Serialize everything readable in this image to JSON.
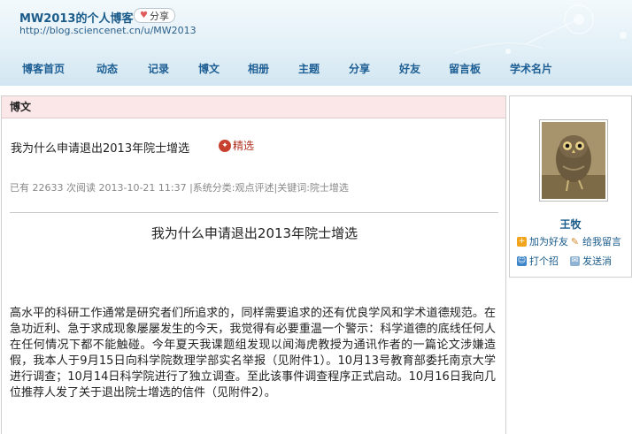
{
  "header": {
    "blog_title": "MW2013的个人博客",
    "share_label": "分享",
    "url": "http://blog.sciencenet.cn/u/MW2013"
  },
  "nav": [
    {
      "id": "home",
      "label": "博客首页"
    },
    {
      "id": "feed",
      "label": "动态"
    },
    {
      "id": "log",
      "label": "记录"
    },
    {
      "id": "blog",
      "label": "博文"
    },
    {
      "id": "album",
      "label": "相册"
    },
    {
      "id": "topic",
      "label": "主题"
    },
    {
      "id": "share",
      "label": "分享"
    },
    {
      "id": "friends",
      "label": "好友"
    },
    {
      "id": "guestbook",
      "label": "留言板"
    },
    {
      "id": "card",
      "label": "学术名片"
    }
  ],
  "section": {
    "title": "博文"
  },
  "article": {
    "title": "我为什么申请退出2013年院士增选",
    "badge": "精选",
    "meta": "已有 22633 次阅读 2013-10-21 11:37  |系统分类:观点评述|关键词:院士增选",
    "heading": "我为什么申请退出2013年院士增选",
    "body": "高水平的科研工作通常是研究者们所追求的，同样需要追求的还有优良学风和学术道德规范。在急功近利、急于求成现象屡屡发生的今天，我觉得有必要重温一个警示：科学道德的底线任何人在任何情况下都不能触碰。今年夏天我课题组发现以闻海虎教授为通讯作者的一篇论文涉嫌造假，我本人于9月15日向科学院数理学部实名举报（见附件1）。10月13号教育部委托南京大学进行调查；10月14日科学院进行了独立调查。至此该事件调查程序正式启动。10月16日我向几位推荐人发了关于退出院士增选的信件（见附件2）。"
  },
  "sidebar": {
    "name": "王牧",
    "links": [
      {
        "id": "add-friend",
        "label": "加为好友",
        "icon": "add-friend-icon"
      },
      {
        "id": "message",
        "label": "给我留言",
        "icon": "pencil-icon"
      },
      {
        "id": "greet",
        "label": "打个招",
        "icon": "greet-icon"
      },
      {
        "id": "pm",
        "label": "发送消",
        "icon": "mail-icon"
      }
    ]
  },
  "colors": {
    "accent": "#1a5b8a",
    "section_head_bg": "#fbe7e7",
    "badge": "#c8412e"
  }
}
